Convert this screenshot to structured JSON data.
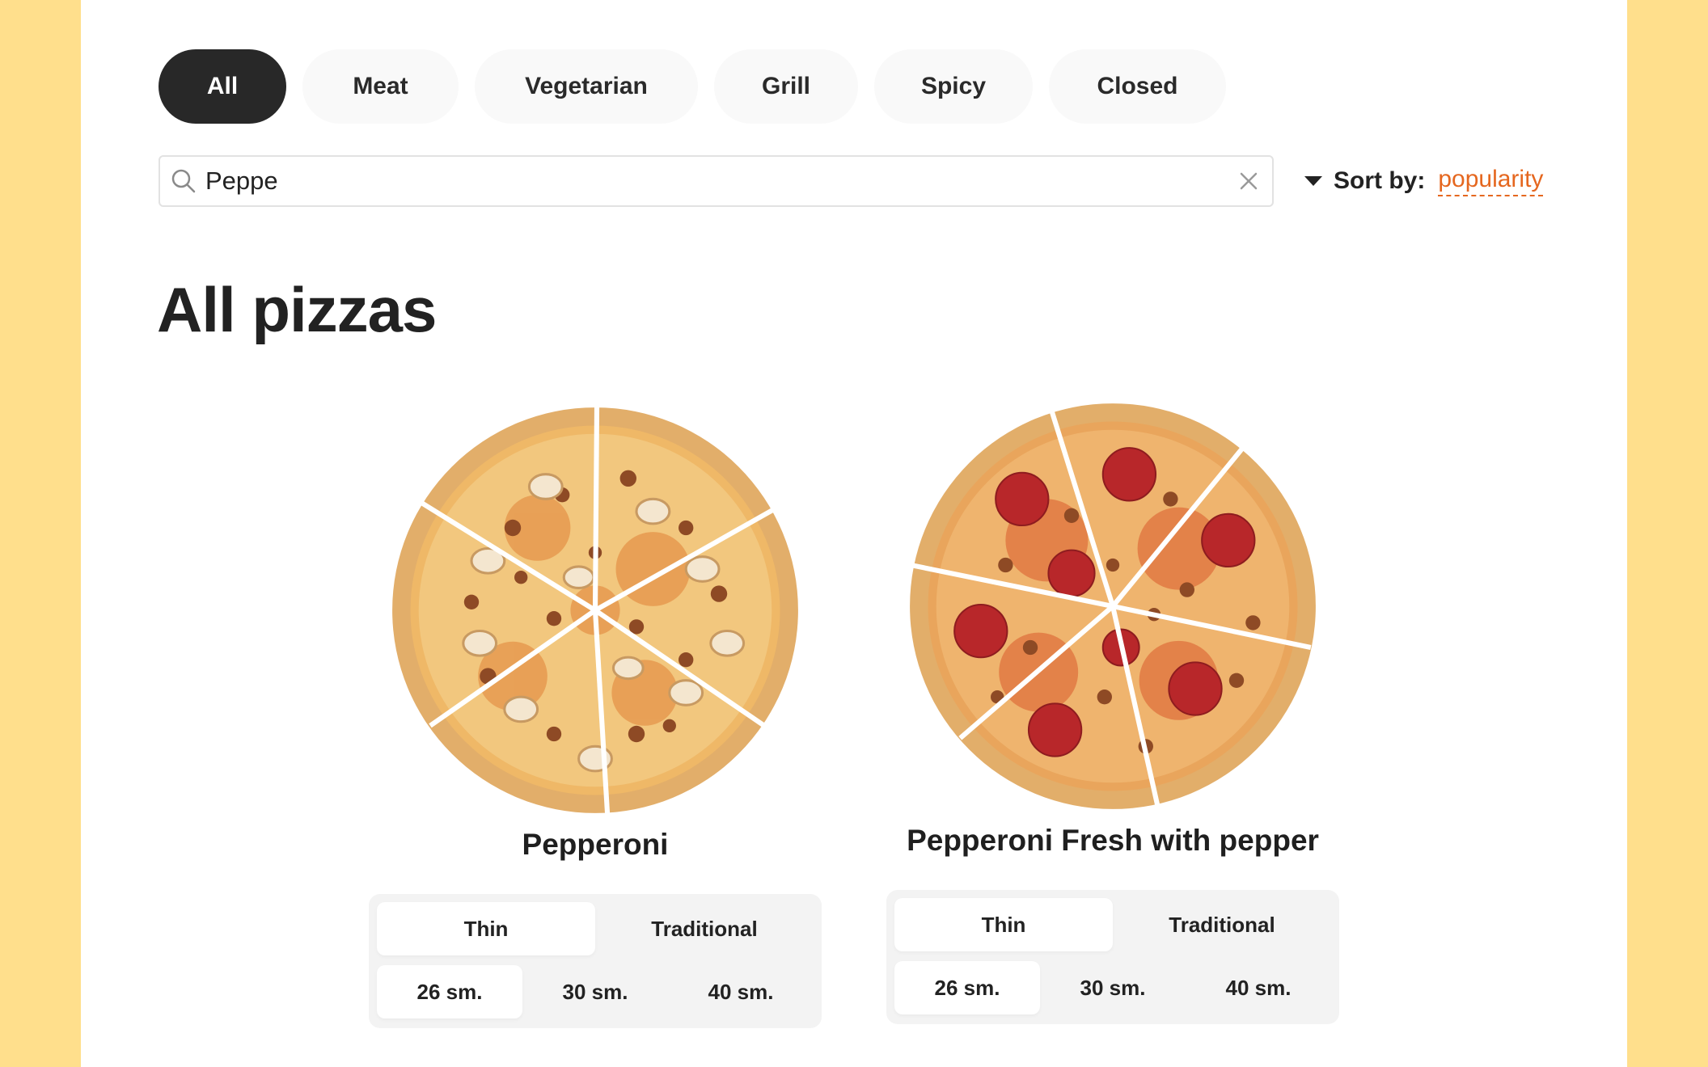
{
  "categories": [
    {
      "label": "All",
      "active": true
    },
    {
      "label": "Meat",
      "active": false
    },
    {
      "label": "Vegetarian",
      "active": false
    },
    {
      "label": "Grill",
      "active": false
    },
    {
      "label": "Spicy",
      "active": false
    },
    {
      "label": "Closed",
      "active": false
    }
  ],
  "search": {
    "value": "Peppe"
  },
  "sort": {
    "label": "Sort by:",
    "value": "popularity"
  },
  "page_title": "All pizzas",
  "pizzas": [
    {
      "name": "Pepperoni",
      "toppings": "mushroom-sausage",
      "dough_options": [
        "Thin",
        "Traditional"
      ],
      "selected_dough": "Thin",
      "size_options": [
        "26 sm.",
        "30 sm.",
        "40 sm."
      ],
      "selected_size": "26 sm."
    },
    {
      "name": "Pepperoni Fresh with pepper",
      "toppings": "pepperoni-sausage",
      "dough_options": [
        "Thin",
        "Traditional"
      ],
      "selected_dough": "Thin",
      "size_options": [
        "26 sm.",
        "30 sm.",
        "40 sm."
      ],
      "selected_size": "26 sm."
    }
  ],
  "colors": {
    "background": "#FFDF8C",
    "active_chip": "#282828",
    "chip": "#F9F9F9",
    "accent": "#E5671F",
    "selector_bg": "#F3F3F3"
  }
}
